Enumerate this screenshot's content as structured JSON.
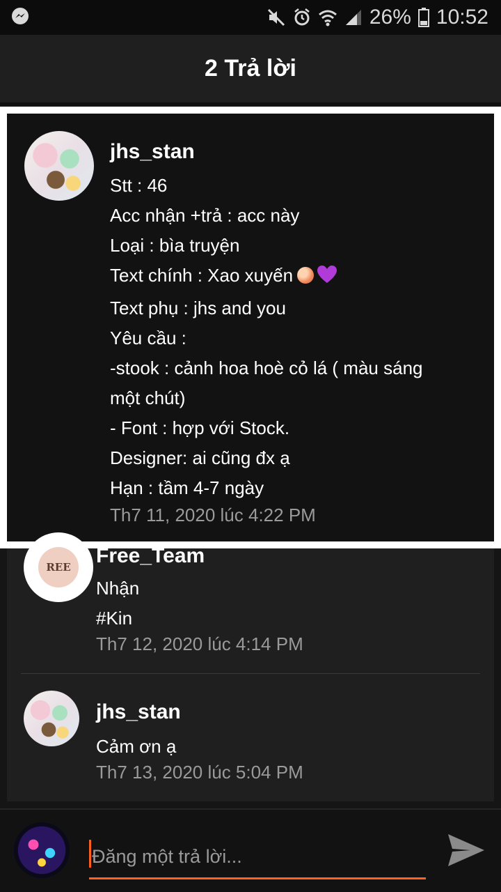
{
  "status_bar": {
    "battery": "26%",
    "time": "10:52",
    "left_icon": "messenger-icon",
    "icons": [
      "mute-icon",
      "alarm-icon",
      "wifi-icon",
      "signal-icon",
      "battery-icon"
    ]
  },
  "header": {
    "title": "2 Trả lời"
  },
  "post": {
    "username": "jhs_stan",
    "lines": [
      "Stt : 46",
      "Acc nhận +trả : acc này",
      "Loại : bìa truyện",
      "Text chính : Xao xuyến",
      "Text phụ : jhs and you",
      "Yêu cầu :",
      "-stook : cảnh hoa hoè cỏ lá ( màu sáng",
      "một chút)",
      "- Font : hợp với Stock.",
      "Designer: ai cũng đx ạ",
      "Hạn : tầm 4-7 ngày"
    ],
    "emoji": [
      "peach-emoji",
      "purple-heart-emoji"
    ],
    "timestamp": "Th7 11, 2020 lúc 4:22 PM"
  },
  "replies": [
    {
      "username": "Free_Team",
      "avatar_text": "REE",
      "lines": [
        "Nhận",
        "#Kin"
      ],
      "timestamp": "Th7 12, 2020 lúc 4:14 PM"
    },
    {
      "username": "jhs_stan",
      "lines": [
        "Cảm ơn ạ"
      ],
      "timestamp": "Th7 13, 2020 lúc 5:04 PM"
    }
  ],
  "compose": {
    "placeholder": "Đăng một trả lời...",
    "send_icon": "send-icon",
    "accent": "#ff5f1f"
  },
  "colors": {
    "background": "#121212",
    "card": "#1f1f1f",
    "timestamp": "#9a9a9a"
  }
}
